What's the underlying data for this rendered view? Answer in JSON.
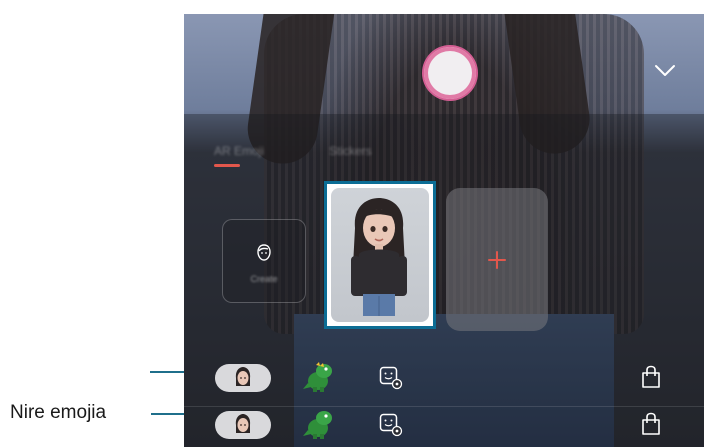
{
  "callout": {
    "label": "Nire emojia"
  },
  "camera": {
    "tabs": [
      {
        "label": "AR Emoji"
      },
      {
        "label": "Stickers"
      }
    ],
    "mini_card_label": "Create",
    "accent_color": "#e2574c",
    "highlight_color": "#0c6d95"
  },
  "toolbar": {
    "icons": [
      "my-emoji",
      "dinosaur",
      "sticker",
      "shopping-bag"
    ]
  }
}
